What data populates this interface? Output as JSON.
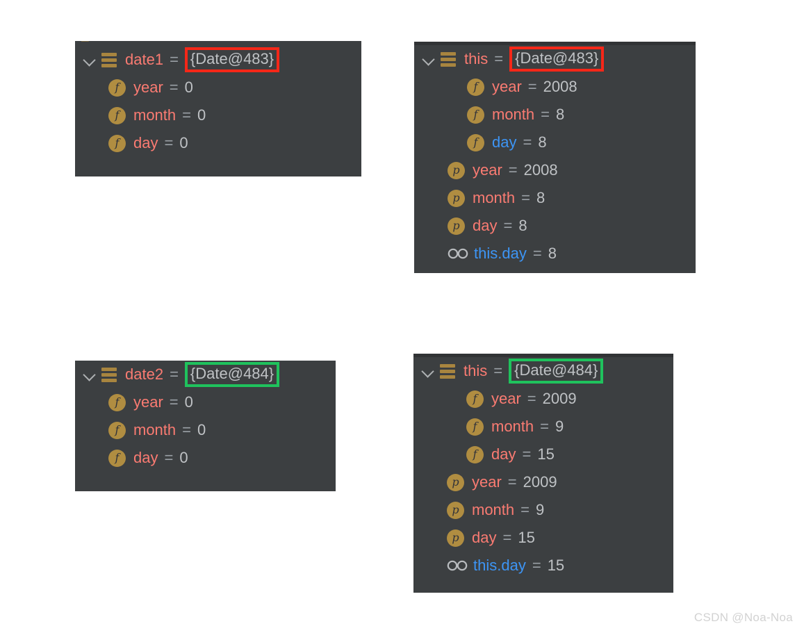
{
  "watermark": "CSDN @Noa-Noa",
  "colors": {
    "panel_background": "#3c3f41",
    "panel_topbar": "#313335",
    "field_name": "#fa7b72",
    "field_name_selected": "#3d95f5",
    "value": "#bfc2c5",
    "equals": "#9aa0a6",
    "badge": "#b08d41",
    "object_icon": "#a8853f",
    "highlight_red": "#f52718",
    "highlight_green": "#1fc25d",
    "page_background": "#ffffff",
    "watermark_text": "#d2d2d2"
  },
  "panels": [
    {
      "id": "panel-date1",
      "has_topbar": false,
      "clipped_top_row": true,
      "rows": [
        {
          "icon": "object-icon",
          "chevron": "chevron-down-icon",
          "indent": 0,
          "name": "date1",
          "name_color": "field_name",
          "equals": "=",
          "value": "{Date@483}",
          "highlight": "red"
        },
        {
          "icon": "field-badge-f",
          "badge_letter": "f",
          "indent": 1,
          "name": "year",
          "name_color": "field_name",
          "equals": "=",
          "value": "0",
          "highlight": "none"
        },
        {
          "icon": "field-badge-f",
          "badge_letter": "f",
          "indent": 1,
          "name": "month",
          "name_color": "field_name",
          "equals": "=",
          "value": "0",
          "highlight": "none"
        },
        {
          "icon": "field-badge-f",
          "badge_letter": "f",
          "indent": 1,
          "name": "day",
          "name_color": "field_name",
          "equals": "=",
          "value": "0",
          "highlight": "none"
        }
      ]
    },
    {
      "id": "panel-this-483",
      "has_topbar": true,
      "clipped_top_row": false,
      "rows": [
        {
          "icon": "object-icon",
          "chevron": "chevron-down-icon",
          "indent": 0,
          "name": "this",
          "name_color": "field_name",
          "equals": "=",
          "value": "{Date@483}",
          "highlight": "red"
        },
        {
          "icon": "field-badge-f",
          "badge_letter": "f",
          "indent": 2,
          "name": "year",
          "name_color": "field_name",
          "equals": "=",
          "value": "2008",
          "highlight": "none"
        },
        {
          "icon": "field-badge-f",
          "badge_letter": "f",
          "indent": 2,
          "name": "month",
          "name_color": "field_name",
          "equals": "=",
          "value": "8",
          "highlight": "none"
        },
        {
          "icon": "field-badge-f",
          "badge_letter": "f",
          "indent": 2,
          "name": "day",
          "name_color": "field_name_selected",
          "equals": "=",
          "value": "8",
          "highlight": "none"
        },
        {
          "icon": "param-badge-p",
          "badge_letter": "p",
          "indent": 1,
          "name": "year",
          "name_color": "field_name",
          "equals": "=",
          "value": "2008",
          "highlight": "none"
        },
        {
          "icon": "param-badge-p",
          "badge_letter": "p",
          "indent": 1,
          "name": "month",
          "name_color": "field_name",
          "equals": "=",
          "value": "8",
          "highlight": "none"
        },
        {
          "icon": "param-badge-p",
          "badge_letter": "p",
          "indent": 1,
          "name": "day",
          "name_color": "field_name",
          "equals": "=",
          "value": "8",
          "highlight": "none"
        },
        {
          "icon": "watch-glasses-icon",
          "indent": 1,
          "name": "this.day",
          "name_color": "field_name_selected",
          "equals": "=",
          "value": "8",
          "highlight": "none"
        }
      ]
    },
    {
      "id": "panel-date2",
      "has_topbar": false,
      "clipped_top_row": false,
      "rows": [
        {
          "icon": "object-icon",
          "chevron": "chevron-down-icon",
          "indent": 0,
          "name": "date2",
          "name_color": "field_name",
          "equals": "=",
          "value": "{Date@484}",
          "highlight": "green"
        },
        {
          "icon": "field-badge-f",
          "badge_letter": "f",
          "indent": 1,
          "name": "year",
          "name_color": "field_name",
          "equals": "=",
          "value": "0",
          "highlight": "none"
        },
        {
          "icon": "field-badge-f",
          "badge_letter": "f",
          "indent": 1,
          "name": "month",
          "name_color": "field_name",
          "equals": "=",
          "value": "0",
          "highlight": "none"
        },
        {
          "icon": "field-badge-f",
          "badge_letter": "f",
          "indent": 1,
          "name": "day",
          "name_color": "field_name",
          "equals": "=",
          "value": "0",
          "highlight": "none"
        }
      ]
    },
    {
      "id": "panel-this-484",
      "has_topbar": true,
      "clipped_top_row": false,
      "rows": [
        {
          "icon": "object-icon",
          "chevron": "chevron-down-icon",
          "indent": 0,
          "name": "this",
          "name_color": "field_name",
          "equals": "=",
          "value": "{Date@484}",
          "highlight": "green"
        },
        {
          "icon": "field-badge-f",
          "badge_letter": "f",
          "indent": 2,
          "name": "year",
          "name_color": "field_name",
          "equals": "=",
          "value": "2009",
          "highlight": "none"
        },
        {
          "icon": "field-badge-f",
          "badge_letter": "f",
          "indent": 2,
          "name": "month",
          "name_color": "field_name",
          "equals": "=",
          "value": "9",
          "highlight": "none"
        },
        {
          "icon": "field-badge-f",
          "badge_letter": "f",
          "indent": 2,
          "name": "day",
          "name_color": "field_name",
          "equals": "=",
          "value": "15",
          "highlight": "none"
        },
        {
          "icon": "param-badge-p",
          "badge_letter": "p",
          "indent": 1,
          "name": "year",
          "name_color": "field_name",
          "equals": "=",
          "value": "2009",
          "highlight": "none"
        },
        {
          "icon": "param-badge-p",
          "badge_letter": "p",
          "indent": 1,
          "name": "month",
          "name_color": "field_name",
          "equals": "=",
          "value": "9",
          "highlight": "none"
        },
        {
          "icon": "param-badge-p",
          "badge_letter": "p",
          "indent": 1,
          "name": "day",
          "name_color": "field_name",
          "equals": "=",
          "value": "15",
          "highlight": "none"
        },
        {
          "icon": "watch-glasses-icon",
          "indent": 1,
          "name": "this.day",
          "name_color": "field_name_selected",
          "equals": "=",
          "value": "15",
          "highlight": "none"
        }
      ]
    }
  ]
}
